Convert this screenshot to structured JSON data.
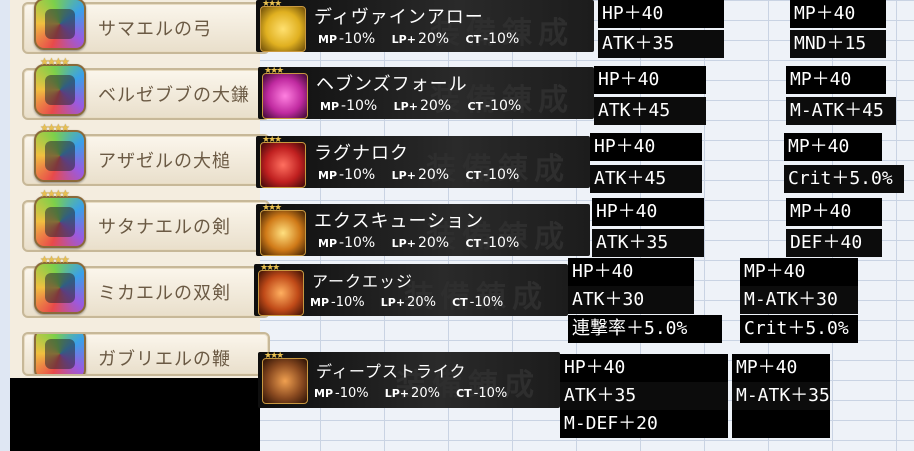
{
  "items": [
    {
      "name": "サマエルの弓"
    },
    {
      "name": "ベルゼブブの大鎌"
    },
    {
      "name": "アザゼルの大槌"
    },
    {
      "name": "サタナエルの剣"
    },
    {
      "name": "ミカエルの双剣"
    },
    {
      "name": "ガブリエルの鞭"
    }
  ],
  "watermark": "装備錬成",
  "skills": [
    {
      "name": "ディヴァインアロー",
      "color": "#e0b020"
    },
    {
      "name": "ヘブンズフォール",
      "color": "#c02aa0"
    },
    {
      "name": "ラグナロク",
      "color": "#c02020"
    },
    {
      "name": "エクスキューション",
      "color": "#d07a18"
    },
    {
      "name": "アークエッジ",
      "color": "#c04a18"
    },
    {
      "name": "ディープストライク",
      "color": "#8a4a20"
    }
  ],
  "skill_stats": {
    "mp_key": "MP",
    "mp_val": "-10%",
    "lp_key": "LP+",
    "lp_val": "20%",
    "ct_key": "CT",
    "ct_val": "-10%"
  },
  "stats": [
    {
      "a": "HP＋40",
      "b": "ATK＋35",
      "c": "MP＋40",
      "d": "MND＋15"
    },
    {
      "a": "HP＋40",
      "b": "ATK＋45",
      "c": "MP＋40",
      "d": "M-ATK＋45"
    },
    {
      "a": "HP＋40",
      "b": "ATK＋45",
      "c": "MP＋40",
      "d": "Crit＋5.0%"
    },
    {
      "a": "HP＋40",
      "b": "ATK＋35",
      "c": "MP＋40",
      "d": "DEF＋40"
    },
    {
      "a": "HP＋40",
      "b": "ATK＋30",
      "e": "連撃率＋5.0%",
      "c": "MP＋40",
      "d": "M-ATK＋30",
      "f": "Crit＋5.0%"
    },
    {
      "a": "HP＋40",
      "b": "ATK＋35",
      "e": "M-DEF＋20",
      "c": "MP＋40",
      "d": "M-ATK＋35"
    }
  ]
}
